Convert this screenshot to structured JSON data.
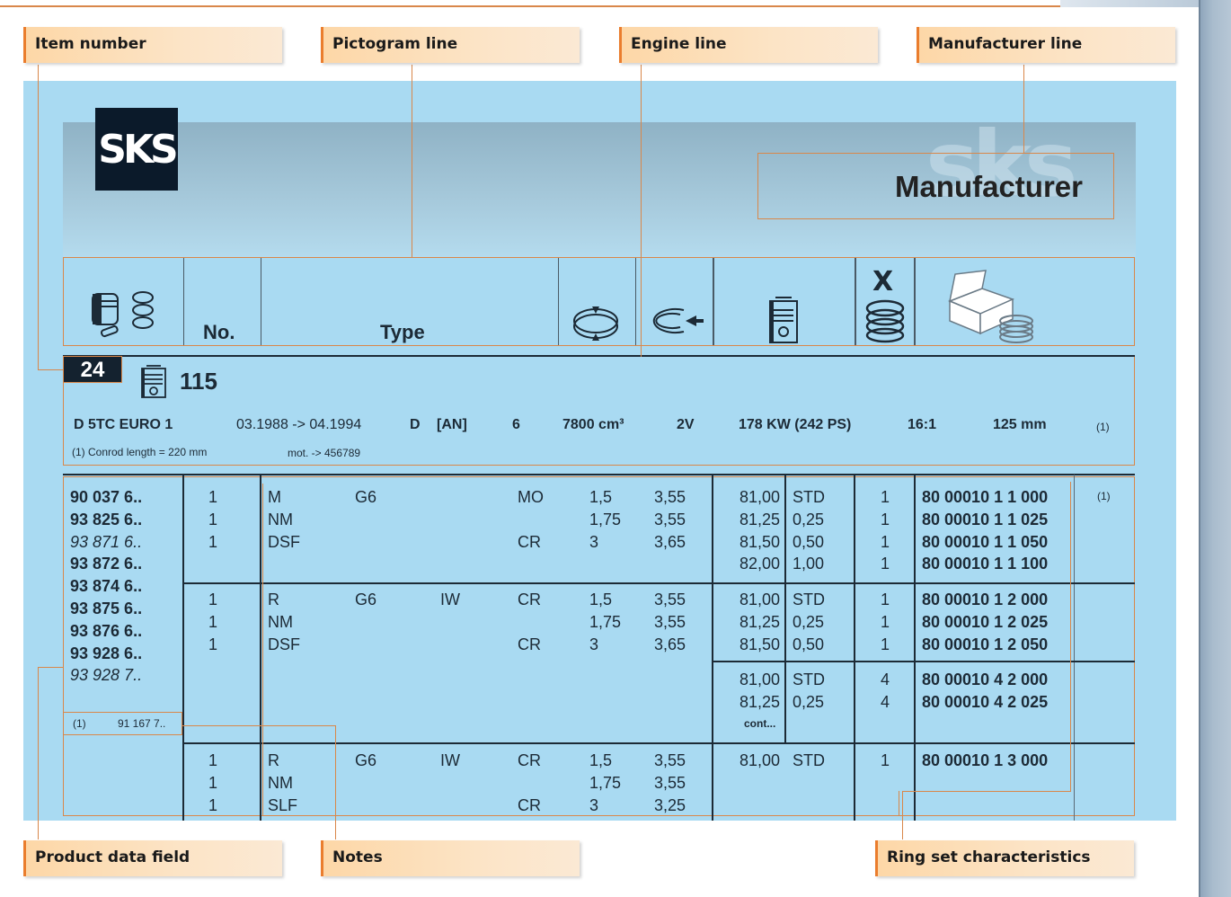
{
  "callouts": {
    "item_number": "Item number",
    "pictogram_line": "Pictogram line",
    "engine_line": "Engine line",
    "manufacturer_line": "Manufacturer line",
    "product_data_field": "Product data field",
    "notes": "Notes",
    "ring_set": "Ring set characteristics"
  },
  "header": {
    "logo_icon": "sks-logo",
    "manufacturer": "Manufacturer"
  },
  "pictogram": {
    "no": "No.",
    "type": "Type",
    "icons": [
      "piston-rings-icon",
      "ring-height-icon",
      "ring-gap-icon",
      "piston-diameter-icon",
      "ring-count-icon",
      "ring-set-box-icon"
    ]
  },
  "engine": {
    "item": "24",
    "cyl": "115",
    "code": "D 5TC EURO 1",
    "period": "03.1988 -> 04.1994",
    "fuel": "D",
    "an": "[AN]",
    "cylinders": "6",
    "displacement": "7800 cm³",
    "valves": "2V",
    "power": "178 KW (242 PS)",
    "compression": "16:1",
    "bore": "125 mm",
    "note_ref": "(1)",
    "note": "(1) Conrod length = 220 mm",
    "mot": "mot. -> 456789"
  },
  "product": {
    "numbers": [
      {
        "t": "90 037 6..",
        "s": "b"
      },
      {
        "t": "93 825 6..",
        "s": "b"
      },
      {
        "t": "93 871 6..",
        "s": "i"
      },
      {
        "t": "93 872 6..",
        "s": "b"
      },
      {
        "t": "93 874 6..",
        "s": "b"
      },
      {
        "t": "93 875 6..",
        "s": "b"
      },
      {
        "t": "93 876 6..",
        "s": "b"
      },
      {
        "t": "93 928 6..",
        "s": "b"
      },
      {
        "t": "93 928 7..",
        "s": "i"
      }
    ],
    "note_ref": "(1)",
    "note_value": "91 167 7..",
    "group1": {
      "qty": "1\n1\n1",
      "type1": "M\nNM\nDSF",
      "type2": "G6",
      "type3": "",
      "type4": "MO\n\nCR",
      "h": "1,5\n1,75\n3",
      "w": "3,55\n3,55\n3,65",
      "dia": "81,00\n81,25\n81,50\n82,00",
      "over": "STD\n0,25\n0,50\n1,00",
      "sets": "1\n1\n1\n1",
      "ref": "80 00010 1 1 000\n80 00010 1 1 025\n80 00010 1 1 050\n80 00010 1 1 100",
      "foot": "(1)"
    },
    "group2": {
      "qty": "1\n1\n1",
      "type1": "R\nNM\nDSF",
      "type2": "G6",
      "type3": "IW",
      "type4": "CR\n\nCR",
      "h": "1,5\n1,75\n3",
      "w": "3,55\n3,55\n3,65",
      "dia": "81,00\n81,25\n81,50",
      "over": "STD\n0,25\n0,50",
      "sets": "1\n1\n1",
      "ref": "80 00010 1 2 000\n80 00010 1 2 025\n80 00010 1 2 050",
      "dia2": "81,00\n81,25",
      "over2": "STD\n0,25",
      "sets2": "4\n4",
      "ref2": "80 00010 4 2 000\n80 00010 4 2 025",
      "cont": "cont..."
    },
    "group3": {
      "qty": "1\n1\n1",
      "type1": "R\nNM\nSLF",
      "type2": "G6",
      "type3": "IW",
      "type4": "CR\n\nCR",
      "h": "1,5\n1,75\n3",
      "w": "3,55\n3,55\n3,25",
      "dia": "81,00",
      "over": "STD",
      "sets": "1",
      "ref": "80 00010 1 3 000"
    }
  },
  "colors": {
    "accent": "#d9874a",
    "panel": "#a9daf2",
    "ink": "#1c2a36"
  }
}
